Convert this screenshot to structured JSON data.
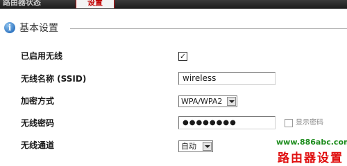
{
  "tabs": {
    "status_label": "路由器状态",
    "settings_label": "设置"
  },
  "section": {
    "title": "基本设置",
    "icon": "info-icon"
  },
  "form": {
    "wireless_enabled": {
      "label": "已启用无线",
      "checked": true,
      "mark": "✓"
    },
    "ssid": {
      "label": "无线名称 (SSID)",
      "value": "wireless"
    },
    "encryption": {
      "label": "加密方式",
      "value": "WPA/WPA2"
    },
    "password": {
      "label": "无线密码",
      "value": "●●●●●●●●",
      "show_label": "显示密码",
      "show_checked": false
    },
    "channel": {
      "label": "无线通道",
      "value": "自动"
    }
  },
  "watermark": {
    "url": "www.886abc.com",
    "title": "路由器设置",
    "url_color": "#1c8c1c",
    "title_color": "#e01010"
  },
  "colors": {
    "tab_active_text": "#c00000",
    "icon_blue": "#2e74c0"
  }
}
